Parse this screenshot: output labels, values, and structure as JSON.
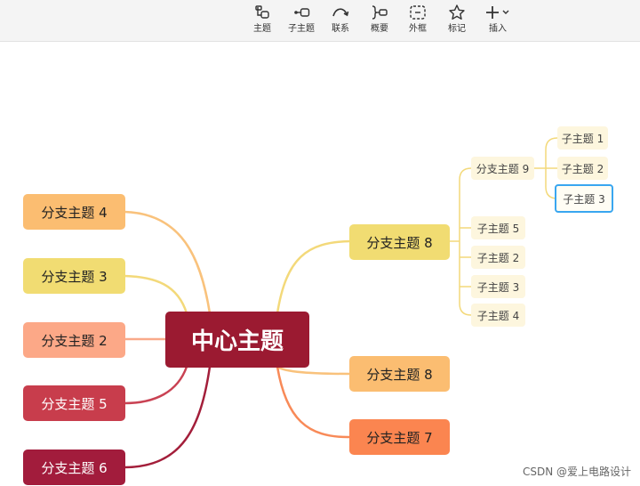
{
  "toolbar": {
    "items": [
      {
        "label": "主题",
        "icon": "topic-icon"
      },
      {
        "label": "子主题",
        "icon": "subtopic-icon"
      },
      {
        "label": "联系",
        "icon": "relationship-icon"
      },
      {
        "label": "概要",
        "icon": "summary-icon"
      },
      {
        "label": "外框",
        "icon": "boundary-icon"
      },
      {
        "label": "标记",
        "icon": "star-icon"
      },
      {
        "label": "插入",
        "icon": "plus-dropdown-icon"
      }
    ]
  },
  "map": {
    "central": {
      "label": "中心主题",
      "color": "#9b1a31"
    },
    "left_branches": [
      {
        "label": "分支主题 4",
        "color": "#fbbd71",
        "line": "#f9c27c"
      },
      {
        "label": "分支主题 3",
        "color": "#f1dc72",
        "line": "#f3d97a"
      },
      {
        "label": "分支主题 2",
        "color": "#fca887",
        "line": "#f9a98a"
      },
      {
        "label": "分支主题 5",
        "color": "#c83d4c",
        "line": "#c94253"
      },
      {
        "label": "分支主题 6",
        "color": "#a21c3c",
        "line": "#a31e3a"
      }
    ],
    "right_branches": [
      {
        "label": "分支主题 8",
        "color": "#f1dc72",
        "line": "#f3d97a"
      },
      {
        "label": "分支主题 8",
        "color": "#fbbd71",
        "line": "#f9c27c"
      },
      {
        "label": "分支主题 7",
        "color": "#fb8550",
        "line": "#f88a58"
      }
    ],
    "subtopics": [
      {
        "label": "分支主题 9"
      },
      {
        "label": "子主题 5"
      },
      {
        "label": "子主题 2"
      },
      {
        "label": "子主题 3"
      },
      {
        "label": "子主题 4"
      }
    ],
    "sub_subtopics": [
      {
        "label": "子主题 1"
      },
      {
        "label": "子主题 2"
      },
      {
        "label": "子主题 3",
        "selected": true
      }
    ]
  },
  "watermark": "CSDN @爱上电路设计"
}
